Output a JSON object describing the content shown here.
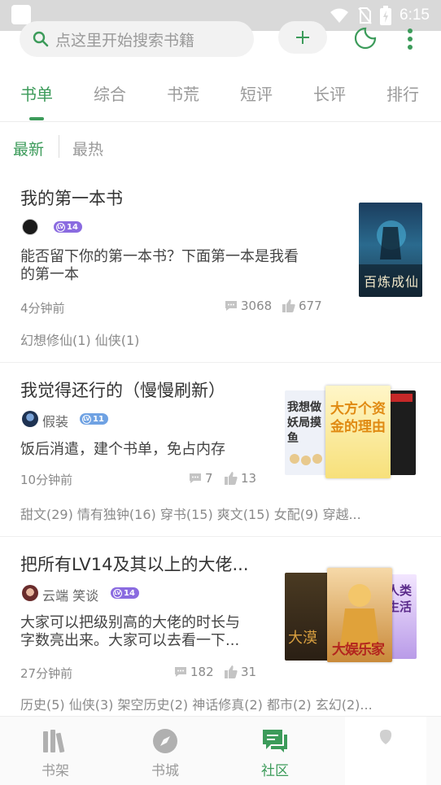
{
  "status": {
    "time": "6:15"
  },
  "search": {
    "placeholder": "点这里开始搜索书籍"
  },
  "tabs": [
    {
      "label": "书单"
    },
    {
      "label": "综合"
    },
    {
      "label": "书荒"
    },
    {
      "label": "短评"
    },
    {
      "label": "长评"
    },
    {
      "label": "排行"
    }
  ],
  "filters": {
    "newest": "最新",
    "hottest": "最热"
  },
  "items": [
    {
      "title": "我的第一本书",
      "author": "",
      "level": "14",
      "desc_line1": "能否留下你的第一本书？下面第一本是我看",
      "desc_line2": "的第一本",
      "time": "4分钟前",
      "comments": "3068",
      "likes": "677",
      "tags": "幻想修仙(1) 仙侠(1)",
      "covers": [
        {
          "text": "百炼成仙"
        }
      ]
    },
    {
      "title": "我觉得还行的（慢慢刷新）",
      "author": "假装",
      "level": "11",
      "desc_line1": "饭后消遣，建个书单，免占内存",
      "desc_line2": "",
      "time": "10分钟前",
      "comments": "7",
      "likes": "13",
      "tags": "甜文(29) 情有独钟(16) 穿书(15) 爽文(15) 女配(9) 穿越...",
      "covers": [
        {
          "text": "我想做妖局摸鱼"
        },
        {
          "text": "大方个资金的理由"
        },
        {
          "text": ""
        }
      ]
    },
    {
      "title": "把所有LV14及其以上的大佬...",
      "author": "云端 笑谈",
      "level": "14",
      "desc_line1": "大家可以把级别高的大佬的时长与",
      "desc_line2": "字数亮出来。大家可以去看一下...",
      "time": "27分钟前",
      "comments": "182",
      "likes": "31",
      "tags": "历史(5) 仙侠(3) 架空历史(2) 神话修真(2) 都市(2) 玄幻(2)...",
      "covers": [
        {
          "text": "大漠"
        },
        {
          "text": "大娱乐家"
        },
        {
          "text": "人类生活"
        }
      ]
    }
  ],
  "nav": [
    {
      "label": "书架"
    },
    {
      "label": "书城"
    },
    {
      "label": "社区"
    },
    {
      "label": ""
    }
  ],
  "colors": {
    "accent": "#3c9b5a",
    "lv_purple": "#8a6be0",
    "lv_blue": "#6fa2e3"
  }
}
